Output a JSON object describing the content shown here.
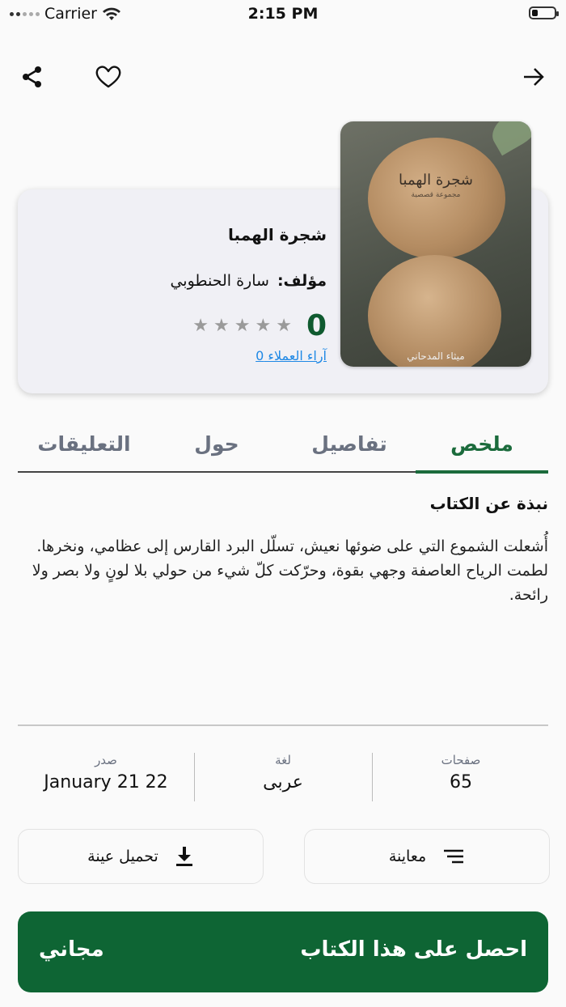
{
  "status_bar": {
    "carrier": "Carrier",
    "time": "2:15 PM"
  },
  "book": {
    "cover_title": "شجرة الهمبا",
    "cover_subtitle": "مجموعة قصصية",
    "cover_author": "ميثاء المدحاني",
    "title": "شجرة الهمبا",
    "author_label": "مؤلف:",
    "author": "سارة الحنطوبي",
    "rating": "0",
    "stars_filled": 0,
    "stars_total": 5,
    "reviews_link": "آراء العملاء 0"
  },
  "tabs": [
    {
      "label": "ملخص",
      "active": true
    },
    {
      "label": "تفاصيل",
      "active": false
    },
    {
      "label": "حول",
      "active": false
    },
    {
      "label": "التعليقات",
      "active": false
    }
  ],
  "about": {
    "title": "نبذة عن الكتاب",
    "text": "أُشعلت الشموع التي على ضوئها نعيش، تسلّل البرد القارس إلى عظامي، ونخرها. لطمت الرياح العاصفة وجهي بقوة، وحرّكت كلّ شيء من حولي بلا لونٍ ولا بصر ولا رائحة."
  },
  "meta": {
    "pages_label": "صفحات",
    "pages_value": "65",
    "language_label": "لغة",
    "language_value": "عربى",
    "published_label": "صدر",
    "published_value": "January 21 22"
  },
  "actions": {
    "preview_label": "معاينة",
    "download_sample_label": "تحميل عينة"
  },
  "cta": {
    "label": "احصل على هذا الكتاب",
    "price": "مجاني"
  },
  "colors": {
    "primary": "#0e6534",
    "link": "#1e88e5",
    "card_bg": "#f0f0f5"
  },
  "icons": {
    "share": "share-icon",
    "favorite": "heart-icon",
    "back": "arrow-right-icon",
    "preview": "menu-lines-icon",
    "download": "download-icon"
  }
}
